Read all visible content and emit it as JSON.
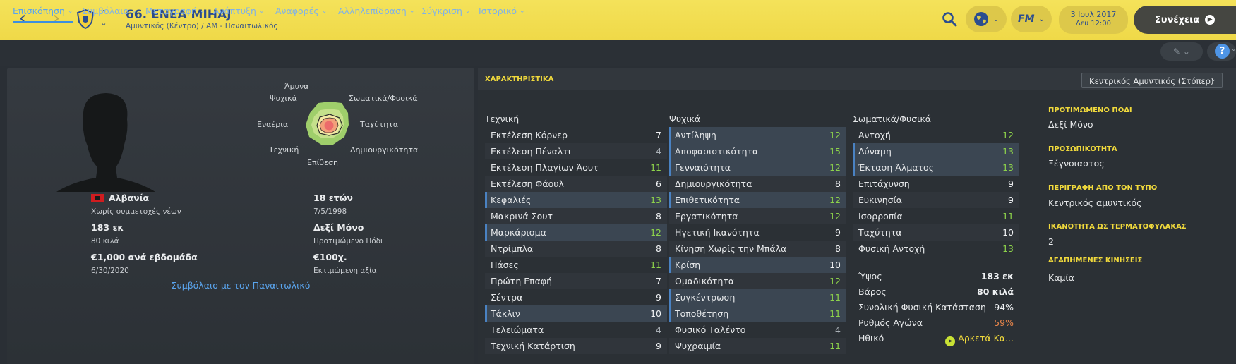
{
  "header": {
    "player_title": "66. ΕΝΕΑ ΜΙΗΑJ",
    "player_subtitle": "Αμυντικός (Κέντρο) / ΑΜ - Παναιτωλικός",
    "date": "3 Ιουλ 2017",
    "time": "Δευ 12:00",
    "continue_label": "Συνέχεια",
    "fm_label": "FM",
    "back_icon": "chevron-left-icon",
    "forward_icon": "chevron-right-icon",
    "colors": {
      "bar": "#f0dc4c",
      "accent": "#2b4d8f"
    }
  },
  "tabs": [
    {
      "label": "Επισκόπηση"
    },
    {
      "label": "Συμβόλαιο"
    },
    {
      "label": "Μεταγραφή"
    },
    {
      "label": "Ανάπτυξη"
    },
    {
      "label": "Αναφορές"
    },
    {
      "label": "Αλληλεπίδραση"
    },
    {
      "label": "Σύγκριση"
    },
    {
      "label": "Ιστορικό"
    }
  ],
  "radar": {
    "labels": {
      "top": "Άμυνα",
      "top_right": "Σωματικά/Φυσικά",
      "right": "Ταχύτητα",
      "bottom_right": "Δημιουργικότητα",
      "bottom": "Επίθεση",
      "bottom_left": "Τεχνική",
      "left": "Εναέρια",
      "top_left": "Ψυχικά"
    }
  },
  "profile": {
    "nationality": "Αλβανία",
    "youth_caps": "Χωρίς συμμετοχές νέων",
    "age": "18 ετών",
    "birth_date": "7/5/1998",
    "height": "183 εκ",
    "weight": "80 κιλά",
    "foot_value": "Δεξί Μόνο",
    "foot_label": "Προτιμώμενο Πόδι",
    "wage": "€1,000 ανά εβδομάδα",
    "contract_end": "6/30/2020",
    "value": "€100χ.",
    "value_label": "Εκτιμώμενη αξία",
    "contract_link": "Συμβόλαιο με τον Παναιτωλικό"
  },
  "attributes": {
    "panel_title": "ΧΑΡΑΚΤΗΡΙΣΤΙΚΑ",
    "role_select": "Κεντρικός Αμυντικός (Στόπερ)",
    "technical": {
      "title": "Τεχνική",
      "items": [
        {
          "name": "Εκτέλεση Κόρνερ",
          "value": "7"
        },
        {
          "name": "Εκτέλεση Πέναλτι",
          "value": "4"
        },
        {
          "name": "Εκτέλεση Πλαγίων Άουτ",
          "value": "11"
        },
        {
          "name": "Εκτέλεση Φάουλ",
          "value": "6"
        },
        {
          "name": "Κεφαλιές",
          "value": "13"
        },
        {
          "name": "Μακρινά Σουτ",
          "value": "8"
        },
        {
          "name": "Μαρκάρισμα",
          "value": "12"
        },
        {
          "name": "Ντρίμπλα",
          "value": "8"
        },
        {
          "name": "Πάσες",
          "value": "11"
        },
        {
          "name": "Πρώτη Επαφή",
          "value": "7"
        },
        {
          "name": "Σέντρα",
          "value": "9"
        },
        {
          "name": "Τάκλιν",
          "value": "10"
        },
        {
          "name": "Τελειώματα",
          "value": "4"
        },
        {
          "name": "Τεχνική Κατάρτιση",
          "value": "9"
        }
      ]
    },
    "mental": {
      "title": "Ψυχικά",
      "items": [
        {
          "name": "Αντίληψη",
          "value": "12"
        },
        {
          "name": "Αποφασιστικότητα",
          "value": "15"
        },
        {
          "name": "Γενναιότητα",
          "value": "12"
        },
        {
          "name": "Δημιουργικότητα",
          "value": "8"
        },
        {
          "name": "Επιθετικότητα",
          "value": "12"
        },
        {
          "name": "Εργατικότητα",
          "value": "12"
        },
        {
          "name": "Ηγετική Ικανότητα",
          "value": "9"
        },
        {
          "name": "Κίνηση Χωρίς την Μπάλα",
          "value": "8"
        },
        {
          "name": "Κρίση",
          "value": "10"
        },
        {
          "name": "Ομαδικότητα",
          "value": "12"
        },
        {
          "name": "Συγκέντρωση",
          "value": "11"
        },
        {
          "name": "Τοποθέτηση",
          "value": "11"
        },
        {
          "name": "Φυσικό Ταλέντο",
          "value": "4"
        },
        {
          "name": "Ψυχραιμία",
          "value": "11"
        }
      ]
    },
    "physical": {
      "title": "Σωματικά/Φυσικά",
      "items": [
        {
          "name": "Αντοχή",
          "value": "12"
        },
        {
          "name": "Δύναμη",
          "value": "13"
        },
        {
          "name": "Έκταση Άλματος",
          "value": "13"
        },
        {
          "name": "Επιτάχυνση",
          "value": "9"
        },
        {
          "name": "Ευκινησία",
          "value": "9"
        },
        {
          "name": "Ισορροπία",
          "value": "11"
        },
        {
          "name": "Ταχύτητα",
          "value": "10"
        },
        {
          "name": "Φυσική Αντοχή",
          "value": "13"
        }
      ]
    },
    "physical_extra": [
      {
        "name": "Ύψος",
        "value": "183 εκ"
      },
      {
        "name": "Βάρος",
        "value": "80 κιλά"
      },
      {
        "name": "Συνολική Φυσική Κατάσταση",
        "value": "94%"
      },
      {
        "name": "Ρυθμός Αγώνα",
        "value": "59%"
      },
      {
        "name": "Ηθικό",
        "value": "Αρκετά Κα..."
      }
    ],
    "value_colors": {
      "high": "#8dd34b",
      "mid": "#f1f3f5",
      "low": "#a9b0b6",
      "warn": "#e8854a"
    }
  },
  "side_info": [
    {
      "label": "ΠΡΟΤΙΜΩΜΕΝΟ ΠΟΔΙ",
      "value": "Δεξί Μόνο"
    },
    {
      "label": "ΠΡΟΣΩΠΙΚΟΤΗΤΑ",
      "value": "Ξέγνοιαστος"
    },
    {
      "label": "ΠΕΡΙΓΡΑΦΗ ΑΠΟ ΤΟΝ ΤΥΠΟ",
      "value": "Κεντρικός αμυντικός"
    },
    {
      "label": "ΙΚΑΝΟΤΗΤΑ ΩΣ ΤΕΡΜΑΤΟΦΥΛΑΚΑΣ",
      "value": "2"
    },
    {
      "label": "ΑΓΑΠΗΜΕΝΕΣ ΚΙΝΗΣΕΙΣ",
      "value": "Καμία"
    }
  ]
}
